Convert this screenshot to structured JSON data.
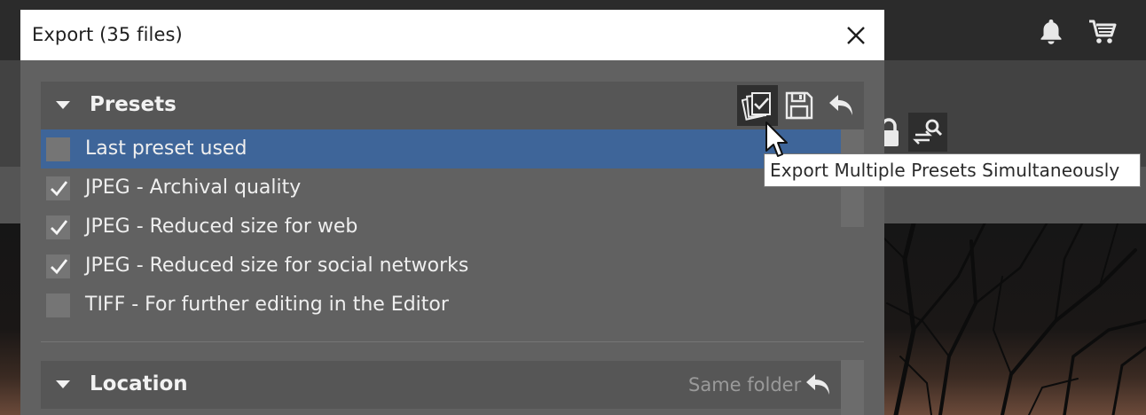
{
  "dialog": {
    "title": "Export (35 files)",
    "close_icon": "close-icon"
  },
  "presets": {
    "title": "Presets",
    "actions": [
      {
        "icon": "multi-preset-icon",
        "active": true
      },
      {
        "icon": "save-icon"
      },
      {
        "icon": "undo-icon"
      }
    ],
    "items": [
      {
        "label": "Last preset used",
        "checked": false,
        "selected": true
      },
      {
        "label": "JPEG - Archival quality",
        "checked": true
      },
      {
        "label": "JPEG - Reduced size for web",
        "checked": true
      },
      {
        "label": "JPEG - Reduced size for social networks",
        "checked": true
      },
      {
        "label": "TIFF - For further editing in the Editor",
        "checked": false
      }
    ]
  },
  "location": {
    "title": "Location",
    "value": "Same folder",
    "reset_icon": "undo-icon"
  },
  "tooltip": {
    "text": "Export Multiple Presets Simultaneously"
  },
  "app": {
    "top_icons": [
      "bell-icon",
      "cart-icon"
    ],
    "toolbar_icons": [
      "lock-icon",
      "swap-search-icon"
    ]
  },
  "colors": {
    "selection": "#3e6599",
    "dialog_bg": "#616161",
    "section_bg": "#565656"
  }
}
